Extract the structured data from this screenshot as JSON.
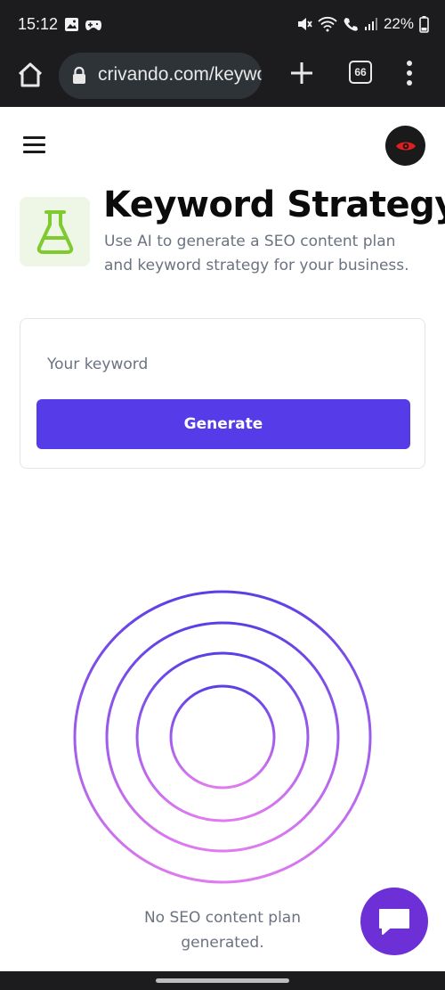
{
  "status_bar": {
    "time": "15:12",
    "battery": "22%",
    "left_icons": [
      "image-icon",
      "game-controller-icon"
    ],
    "right_icons": [
      "mute-icon",
      "wifi-icon",
      "call-icon",
      "signal-icon",
      "battery-icon"
    ]
  },
  "browser": {
    "url": "crivando.com/keyword-strategy",
    "tab_count": "66",
    "icons": [
      "home-icon",
      "lock-icon",
      "plus-icon",
      "tabs-icon",
      "overflow-menu-icon"
    ]
  },
  "header": {
    "menu_icon": "hamburger-icon",
    "avatar_icon": "eye-icon"
  },
  "tool": {
    "icon": "flask-icon",
    "title": "Keyword Strategy",
    "subtitle": "Use AI to generate a SEO content plan and keyword strategy for your business."
  },
  "form": {
    "keyword_placeholder": "Your keyword",
    "keyword_value": "",
    "generate_label": "Generate"
  },
  "empty_state": {
    "message": "No SEO content plan generated.",
    "illustration": "concentric-rings"
  },
  "chat": {
    "icon": "chat-bubble-icon"
  },
  "colors": {
    "accent": "#553ce8",
    "chat_button": "#6d2fd6",
    "ring_gradient_top": "#5b3fe6",
    "ring_gradient_bottom": "#e07af0",
    "flask_green": "#7fcb2f",
    "eye_red": "#e01e1e"
  }
}
